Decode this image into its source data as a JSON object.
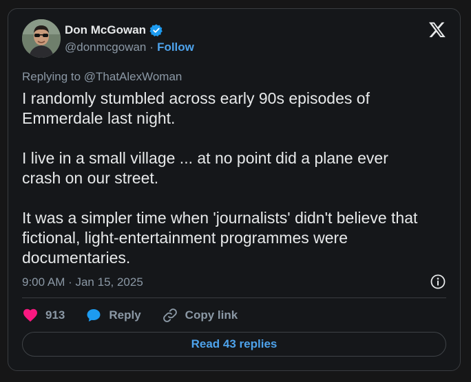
{
  "author": {
    "name": "Don McGowan",
    "handle": "@donmcgowan",
    "separator": "·",
    "follow_label": "Follow",
    "verified_icon": "verified-badge-icon",
    "verified_color": "#1d9bf0"
  },
  "reply_context": "Replying to @ThatAlexWoman",
  "tweet_text": "I randomly stumbled across early 90s episodes of\nEmmerdale last night.\n\nI live in a small village ... at no point did a plane ever\ncrash on our street.\n\nIt was a simpler time when 'journalists' didn't believe that\nfictional, light-entertainment programmes were\ndocumentaries.",
  "timestamp": "9:00 AM · Jan 15, 2025",
  "actions": {
    "like_count": "913",
    "like_color": "#f91880",
    "reply_label": "Reply",
    "reply_color": "#1d9bf0",
    "copy_link_label": "Copy link"
  },
  "read_replies_label": "Read 43 replies",
  "accent_color": "#4ea3ec",
  "icons": [
    "x-logo-icon",
    "info-icon",
    "heart-icon",
    "reply-bubble-icon",
    "link-icon"
  ]
}
